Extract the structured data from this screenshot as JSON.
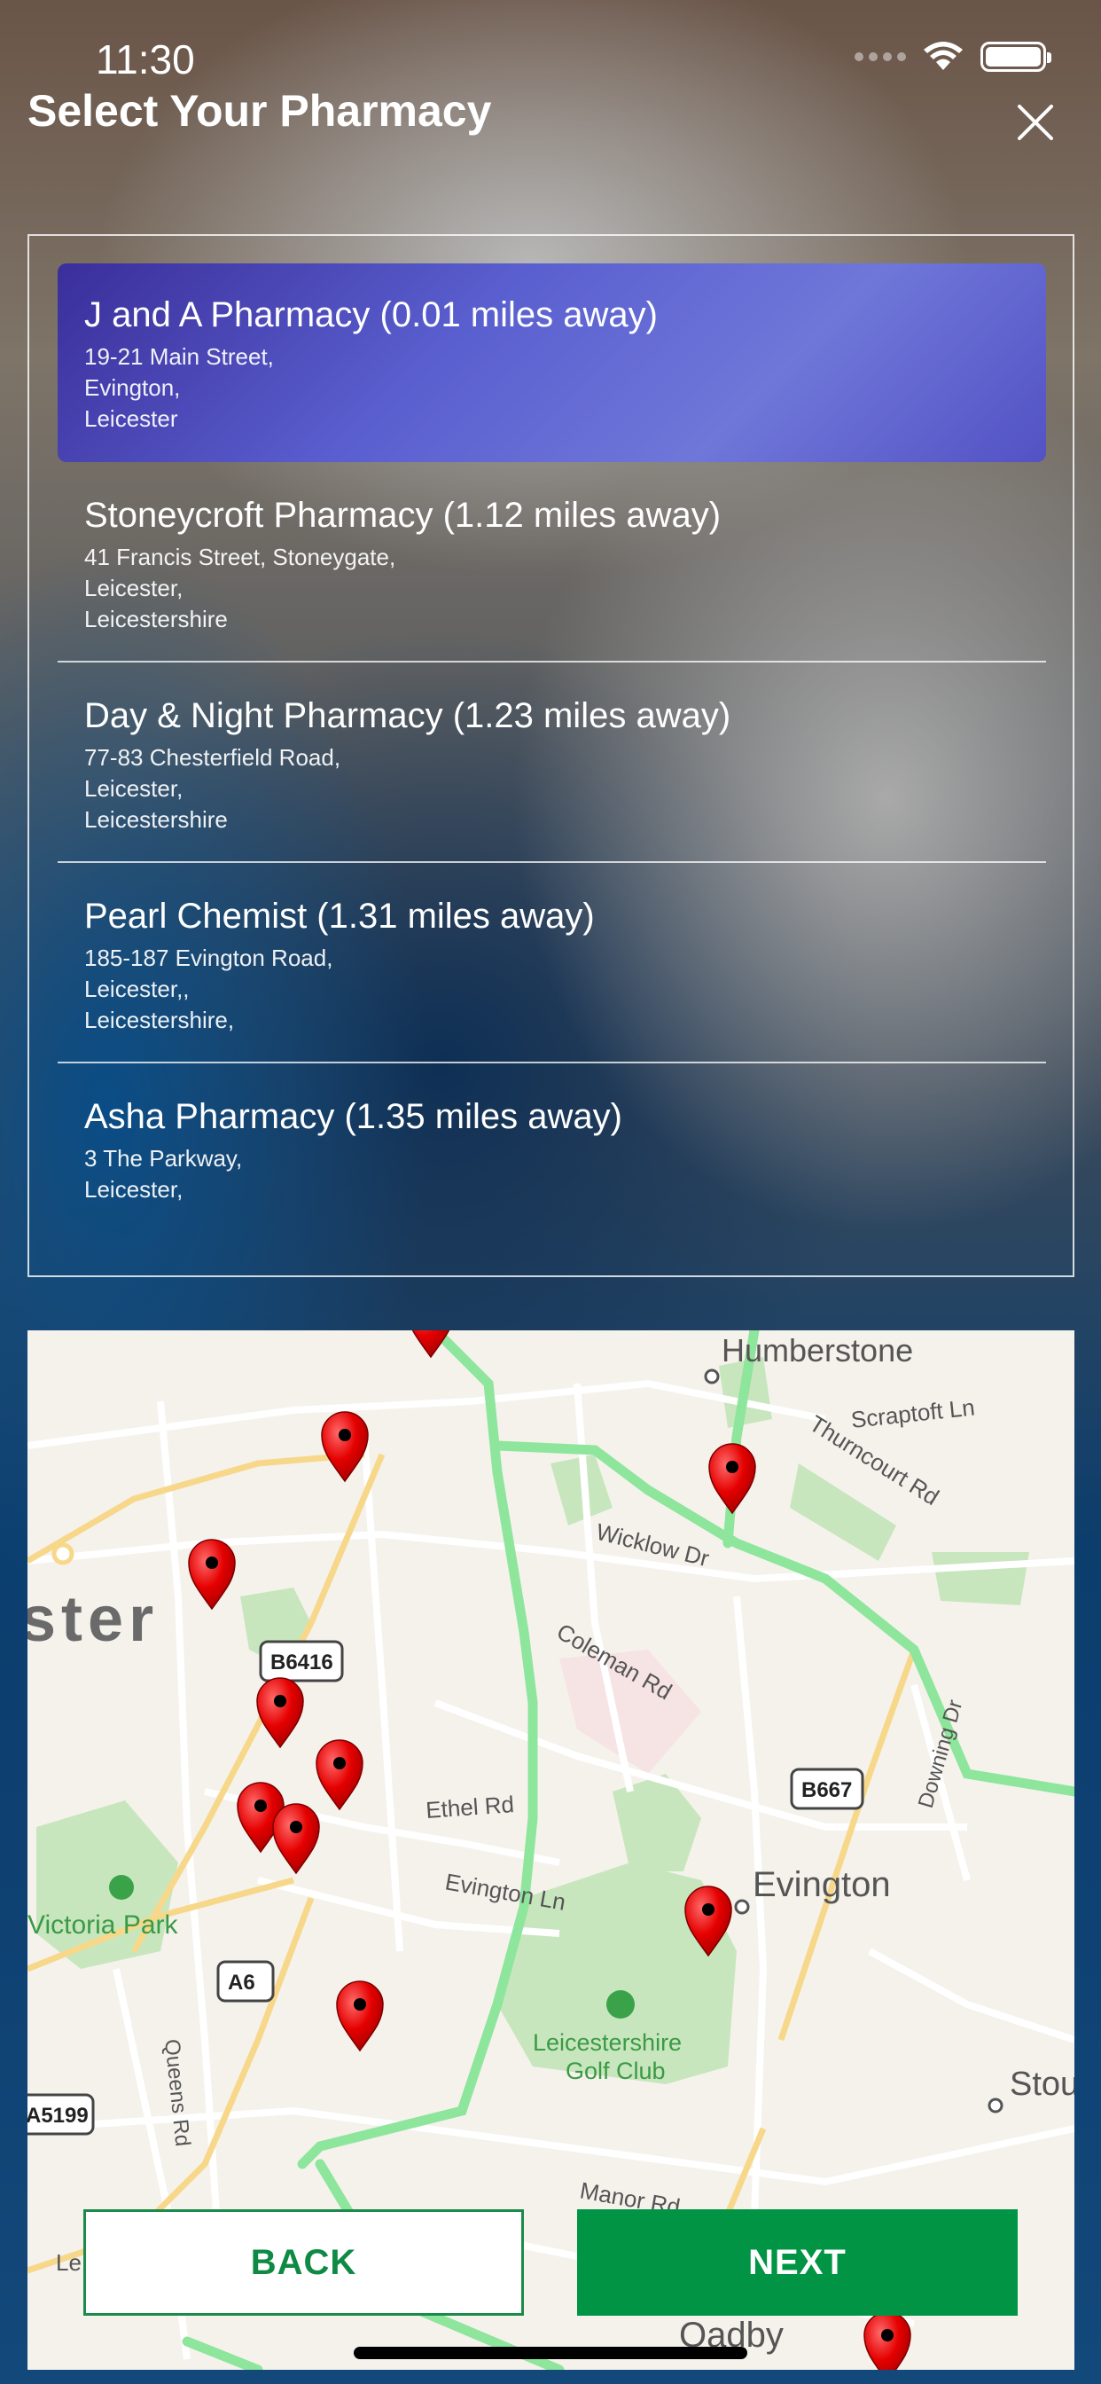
{
  "status_bar": {
    "time": "11:30",
    "icons": [
      "signal-icon",
      "wifi-icon",
      "battery-icon"
    ]
  },
  "header": {
    "title": "Select Your Pharmacy",
    "close_icon": "close-icon"
  },
  "pharmacies": [
    {
      "name": "J and A Pharmacy (0.01 miles away)",
      "address": [
        "19-21 Main Street,",
        "Evington,",
        "Leicester"
      ],
      "selected": true
    },
    {
      "name": "Stoneycroft Pharmacy (1.12 miles away)",
      "address": [
        "41 Francis Street, Stoneygate,",
        "Leicester,",
        "Leicestershire"
      ],
      "selected": false
    },
    {
      "name": "Day & Night Pharmacy (1.23 miles away)",
      "address": [
        "77-83 Chesterfield Road,",
        "Leicester,",
        "Leicestershire"
      ],
      "selected": false
    },
    {
      "name": "Pearl Chemist (1.31 miles away)",
      "address": [
        "185-187 Evington Road,",
        "Leicester,,",
        "Leicestershire,"
      ],
      "selected": false
    },
    {
      "name": "Asha Pharmacy (1.35 miles away)",
      "address": [
        "3 The Parkway,",
        "Leicester,"
      ],
      "selected": false
    }
  ],
  "map": {
    "labels": {
      "humberstone": "Humberstone",
      "scraptoft": "Scraptoft Ln",
      "thurncourt": "Thurncourt Rd",
      "wicklow": "Wicklow Dr",
      "coleman": "Coleman Rd",
      "leicester_partial": "ster",
      "downing": "Downing Dr",
      "ethel": "Ethel Rd",
      "evington_ln": "Evington Ln",
      "evington": "Evington",
      "victoria_park": "Victoria Park",
      "queens": "Queens Rd",
      "golf1": "Leicestershire",
      "golf2": "Golf Club",
      "stou": "Stou",
      "manor": "Manor Rd",
      "oadby": "Oadby",
      "le": "Le"
    },
    "shields": {
      "b6416": "B6416",
      "b667": "B667",
      "a6": "A6",
      "a5199": "A5199"
    },
    "marker_icon": "map-pin-icon"
  },
  "buttons": {
    "back": "BACK",
    "next": "NEXT"
  },
  "colors": {
    "selected_gradient": "#5a5fcf",
    "primary_green": "#009444",
    "marker_red": "#e50000"
  }
}
